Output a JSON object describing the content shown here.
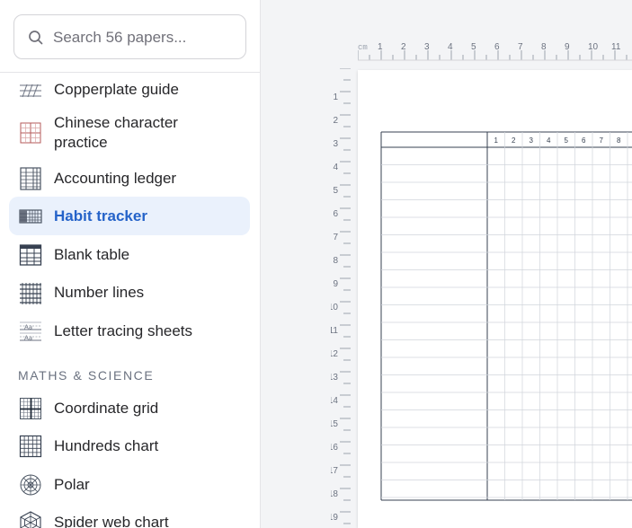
{
  "search": {
    "placeholder": "Search 56 papers..."
  },
  "sidebar": {
    "items": [
      {
        "label": "Copperplate guide",
        "icon": "copperplate-icon"
      },
      {
        "label": "Chinese character practice",
        "icon": "chinese-grid-icon"
      },
      {
        "label": "Accounting ledger",
        "icon": "ledger-icon"
      },
      {
        "label": "Habit tracker",
        "icon": "habit-tracker-icon",
        "active": true
      },
      {
        "label": "Blank table",
        "icon": "table-icon"
      },
      {
        "label": "Number lines",
        "icon": "number-lines-icon"
      },
      {
        "label": "Letter tracing sheets",
        "icon": "letter-tracing-icon"
      }
    ],
    "section_maths": {
      "title": "MATHS & SCIENCE",
      "items": [
        {
          "label": "Coordinate grid",
          "icon": "coordinate-grid-icon"
        },
        {
          "label": "Hundreds chart",
          "icon": "hundreds-chart-icon"
        },
        {
          "label": "Polar",
          "icon": "polar-icon"
        },
        {
          "label": "Spider web chart",
          "icon": "spider-web-icon"
        }
      ]
    }
  },
  "ruler": {
    "h_unit": "cm",
    "h_ticks": [
      "1",
      "2",
      "3",
      "4",
      "5",
      "6",
      "7",
      "8",
      "9",
      "10",
      "11"
    ],
    "v_ticks": [
      "1",
      "2",
      "3",
      "4",
      "5",
      "6",
      "7",
      "8",
      "9",
      "10",
      "11",
      "12",
      "13",
      "14",
      "15",
      "16",
      "17",
      "18",
      "19"
    ]
  },
  "tracker": {
    "day_numbers": [
      "1",
      "2",
      "3",
      "4",
      "5",
      "6",
      "7",
      "8"
    ]
  },
  "colors": {
    "accent": "#2563c9",
    "active_bg": "#eaf1fc"
  }
}
